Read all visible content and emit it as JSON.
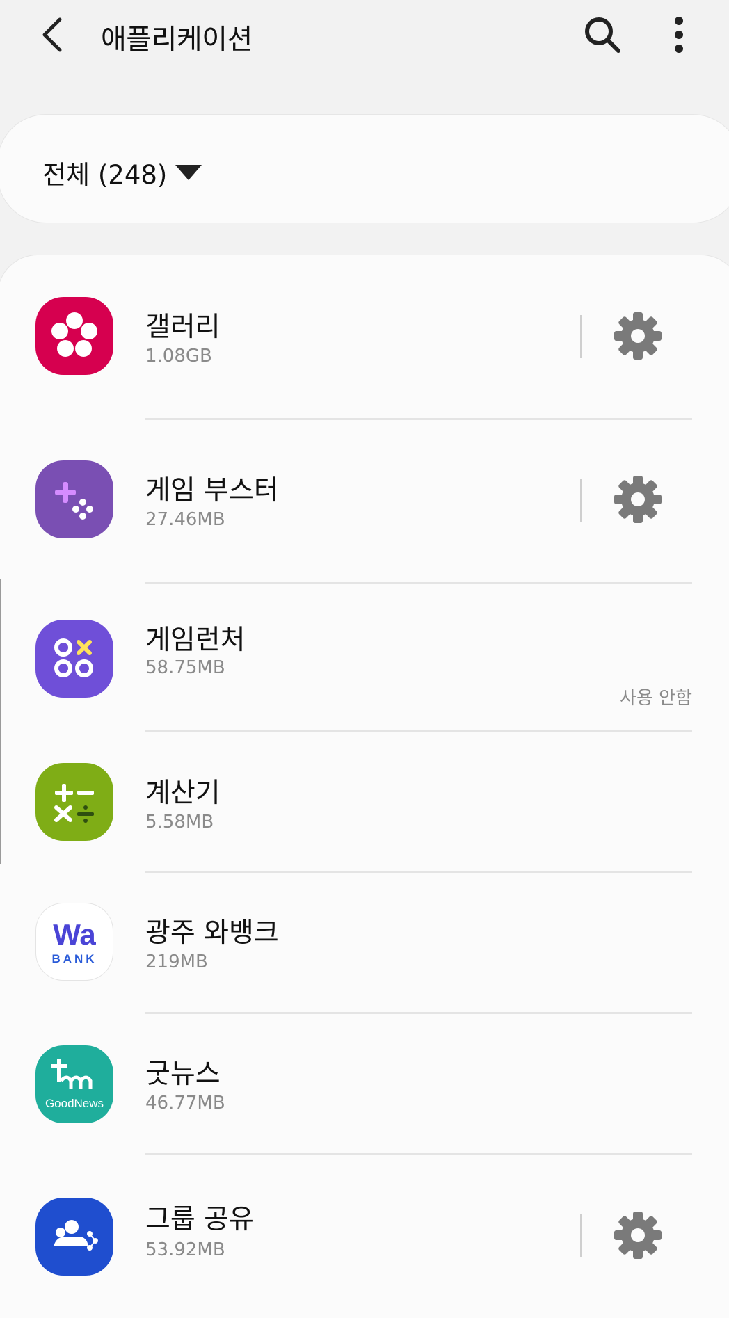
{
  "header": {
    "title": "애플리케이션",
    "back_icon": "back-arrow-icon",
    "search_icon": "search-icon",
    "more_icon": "more-vertical-icon"
  },
  "filter": {
    "label": "전체 (248)",
    "dropdown_icon": "triangle-down-icon"
  },
  "apps": [
    {
      "name": "갤러리",
      "size": "1.08GB",
      "icon": "gallery-flower-icon",
      "icon_color": "#d6004f",
      "settings": true,
      "status": ""
    },
    {
      "name": "게임 부스터",
      "size": "27.46MB",
      "icon": "game-booster-icon",
      "icon_color": "#7a4fb3",
      "settings": true,
      "status": ""
    },
    {
      "name": "게임런처",
      "size": "58.75MB",
      "icon": "game-launcher-icon",
      "icon_color": "#6f4fd8",
      "settings": false,
      "status": "사용 안함"
    },
    {
      "name": "계산기",
      "size": "5.58MB",
      "icon": "calculator-icon",
      "icon_color": "#7fad16",
      "settings": false,
      "status": ""
    },
    {
      "name": "광주 와뱅크",
      "size": "219MB",
      "icon": "wabank-icon",
      "icon_color": "#ffffff",
      "settings": false,
      "status": ""
    },
    {
      "name": "굿뉴스",
      "size": "46.77MB",
      "icon": "goodnews-icon",
      "icon_color": "#1fae9c",
      "settings": false,
      "status": ""
    },
    {
      "name": "그룹 공유",
      "size": "53.92MB",
      "icon": "group-share-icon",
      "icon_color": "#1f4ecf",
      "settings": true,
      "status": ""
    }
  ],
  "icon_text": {
    "wabank_top": "Wa",
    "wabank_bottom": "BANK",
    "goodnews": "GoodNews"
  },
  "colors": {
    "background": "#f2f2f2",
    "card": "#fbfbfb",
    "secondary_text": "#8a8a8a",
    "gear": "#7a7a7a"
  }
}
